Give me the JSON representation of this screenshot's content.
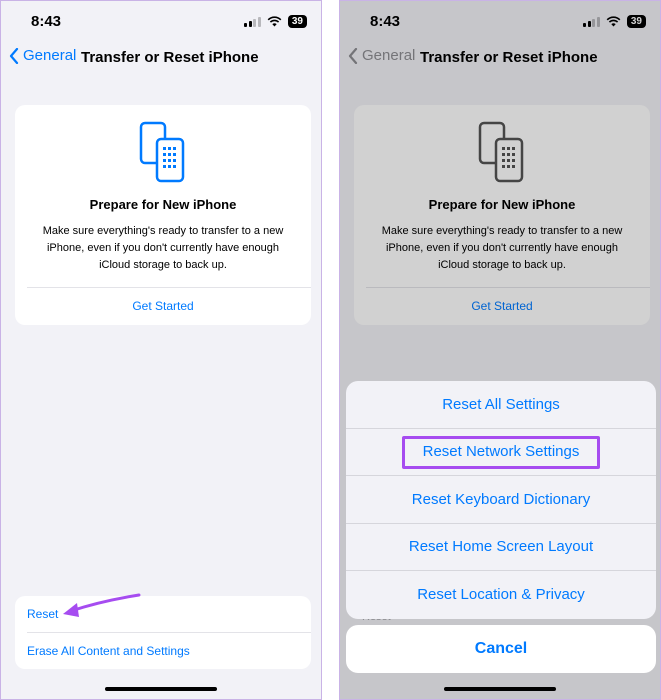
{
  "status": {
    "time": "8:43",
    "battery": "39"
  },
  "nav": {
    "back_label": "General",
    "title": "Transfer or Reset iPhone"
  },
  "card": {
    "title": "Prepare for New iPhone",
    "description": "Make sure everything's ready to transfer to a new iPhone, even if you don't currently have enough iCloud storage to back up.",
    "link": "Get Started"
  },
  "reset_group": {
    "reset": "Reset",
    "erase": "Erase All Content and Settings"
  },
  "sheet": {
    "options": [
      "Reset All Settings",
      "Reset Network Settings",
      "Reset Keyboard Dictionary",
      "Reset Home Screen Layout",
      "Reset Location & Privacy"
    ],
    "cancel": "Cancel",
    "peek": "Reset"
  },
  "colors": {
    "accent": "#007aff",
    "highlight": "#a64cf0",
    "background": "#f2f2f7"
  }
}
